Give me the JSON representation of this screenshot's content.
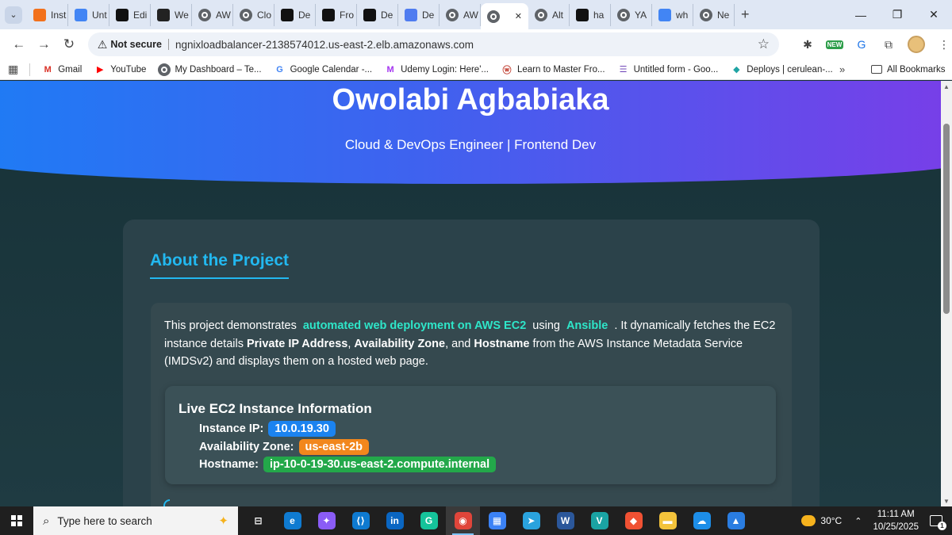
{
  "tabs": [
    {
      "label": "Inst",
      "icon": "orange-square-icon",
      "color": "#f2711c"
    },
    {
      "label": "Unt",
      "icon": "docs-icon",
      "color": "#4285f4"
    },
    {
      "label": "Edi",
      "icon": "medium-icon",
      "color": "#111111"
    },
    {
      "label": "We",
      "icon": "openai-icon",
      "color": "#222222"
    },
    {
      "label": "AW",
      "icon": "globe-icon",
      "color": "#5f6368"
    },
    {
      "label": "Clo",
      "icon": "globe-icon",
      "color": "#5f6368"
    },
    {
      "label": "De",
      "icon": "medium-icon",
      "color": "#111111"
    },
    {
      "label": "Fro",
      "icon": "medium-icon",
      "color": "#111111"
    },
    {
      "label": "De",
      "icon": "medium-icon",
      "color": "#111111"
    },
    {
      "label": "De",
      "icon": "azure-icon",
      "color": "#4f7cf0"
    },
    {
      "label": "AW",
      "icon": "globe-icon",
      "color": "#5f6368"
    }
  ],
  "tabs_after": [
    {
      "label": "Alt",
      "icon": "globe-icon",
      "color": "#5f6368"
    },
    {
      "label": "ha",
      "icon": "github-icon",
      "color": "#111111"
    },
    {
      "label": "YA",
      "icon": "globe-icon",
      "color": "#5f6368"
    },
    {
      "label": "wh",
      "icon": "google-icon",
      "color": "#4285f4"
    },
    {
      "label": "Ne",
      "icon": "globe-icon",
      "color": "#5f6368"
    }
  ],
  "active_tab": {
    "close": "✕"
  },
  "address": {
    "security_label": "Not secure",
    "url": "ngnixloadbalancer-2138574012.us-east-2.elb.amazonaws.com"
  },
  "toolbar_icons": {
    "new_badge": "NEW"
  },
  "bookmarks": [
    {
      "label": "Gmail",
      "icon": "gmail-icon",
      "color": "#d93025",
      "glyph": "M"
    },
    {
      "label": "YouTube",
      "icon": "youtube-icon",
      "color": "#ff0000",
      "glyph": "▶"
    },
    {
      "label": "My Dashboard – Te...",
      "icon": "globe-icon",
      "color": "#5f6368",
      "glyph": ""
    },
    {
      "label": "Google Calendar -...",
      "icon": "google-icon",
      "color": "#4285f4",
      "glyph": "G"
    },
    {
      "label": "Udemy Login: Here'...",
      "icon": "udemy-icon",
      "color": "#a435f0",
      "glyph": "M"
    },
    {
      "label": "Learn to Master Fro...",
      "icon": "learn-icon",
      "color": "#c0392b",
      "glyph": "ⓦ"
    },
    {
      "label": "Untitled form - Goo...",
      "icon": "forms-icon",
      "color": "#7248b9",
      "glyph": "☰"
    },
    {
      "label": "Deploys | cerulean-...",
      "icon": "netlify-icon",
      "color": "#20a4a4",
      "glyph": "◆"
    }
  ],
  "bookmarks_more": "»",
  "bookmarks_all": "All Bookmarks",
  "hero": {
    "name": "Owolabi Agbabiaka",
    "subtitle": "Cloud & DevOps Engineer | Frontend Dev"
  },
  "about": {
    "title": "About the Project",
    "text1": "This project demonstrates",
    "highlight1": "automated web deployment on AWS EC2",
    "text2": "using",
    "highlight2": "Ansible",
    "text3": ". It dynamically fetches the EC2 instance details",
    "bold1": "Private IP Address",
    "text4": ",",
    "bold2": "Availability Zone",
    "text5": ", and",
    "bold3": "Hostname",
    "text6": "from the AWS Instance Metadata Service (IMDSv2) and displays them on a hosted web page."
  },
  "instance": {
    "title": "Live EC2 Instance Information",
    "ip_label": "Instance IP:",
    "ip_value": "10.0.19.30",
    "az_label": "Availability Zone:",
    "az_value": "us-east-2b",
    "host_label": "Hostname:",
    "host_value": "ip-10-0-19-30.us-east-2.compute.internal"
  },
  "taskbar": {
    "search_placeholder": "Type here to search",
    "apps": [
      {
        "name": "task-view-icon",
        "glyph": "⊟",
        "color": "#1f1f1f",
        "active": false
      },
      {
        "name": "edge-icon",
        "glyph": "e",
        "color": "#0f7bd1",
        "active": false
      },
      {
        "name": "copilot-icon",
        "glyph": "✦",
        "color": "#8a5cf6",
        "active": false
      },
      {
        "name": "vscode-icon",
        "glyph": "⟨⟩",
        "color": "#0e7ad0",
        "active": false
      },
      {
        "name": "linkedin-icon",
        "glyph": "in",
        "color": "#0a66c2",
        "active": false
      },
      {
        "name": "grammarly-icon",
        "glyph": "G",
        "color": "#15c39a",
        "active": false
      },
      {
        "name": "chrome-icon",
        "glyph": "◉",
        "color": "#e0453a",
        "active": true
      },
      {
        "name": "store-icon",
        "glyph": "▦",
        "color": "#3b82f6",
        "active": false
      },
      {
        "name": "telegram-icon",
        "glyph": "➤",
        "color": "#2aa3de",
        "active": false
      },
      {
        "name": "word-icon",
        "glyph": "W",
        "color": "#2b579a",
        "active": false
      },
      {
        "name": "vs-icon",
        "glyph": "V",
        "color": "#1aa3a3",
        "active": false
      },
      {
        "name": "git-icon",
        "glyph": "◆",
        "color": "#f05133",
        "active": false
      },
      {
        "name": "file-explorer-icon",
        "glyph": "▬",
        "color": "#f3c33b",
        "active": false
      },
      {
        "name": "onedrive-icon",
        "glyph": "☁",
        "color": "#1d8ee8",
        "active": false
      },
      {
        "name": "photos-icon",
        "glyph": "▲",
        "color": "#2a7de1",
        "active": false
      }
    ],
    "temperature": "30°C",
    "time": "11:11 AM",
    "date": "10/25/2025",
    "notification_count": "1"
  }
}
